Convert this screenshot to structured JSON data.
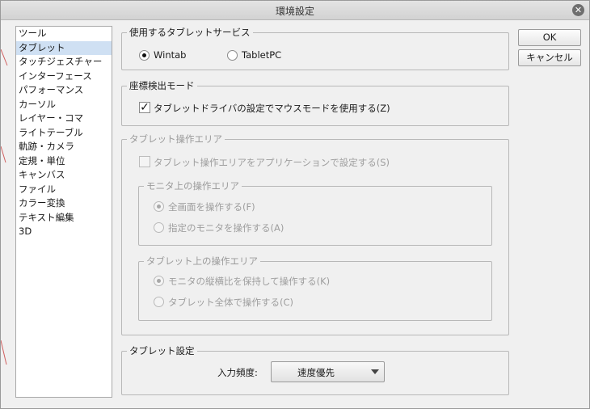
{
  "window": {
    "title": "環境設定"
  },
  "sidebar": {
    "items": [
      {
        "label": "ツール"
      },
      {
        "label": "タブレット"
      },
      {
        "label": "タッチジェスチャー"
      },
      {
        "label": "インターフェース"
      },
      {
        "label": "パフォーマンス"
      },
      {
        "label": "カーソル"
      },
      {
        "label": "レイヤー・コマ"
      },
      {
        "label": "ライトテーブル"
      },
      {
        "label": "軌跡・カメラ"
      },
      {
        "label": "定規・単位"
      },
      {
        "label": "キャンバス"
      },
      {
        "label": "ファイル"
      },
      {
        "label": "カラー変換"
      },
      {
        "label": "テキスト編集"
      },
      {
        "label": "3D"
      }
    ],
    "selected": "タブレット"
  },
  "buttons": {
    "ok": "OK",
    "cancel": "キャンセル"
  },
  "tablet_service": {
    "legend": "使用するタブレットサービス",
    "wintab": "Wintab",
    "tabletpc": "TabletPC",
    "selected": "Wintab"
  },
  "coordinate": {
    "legend": "座標検出モード",
    "mouse_mode_label": "タブレットドライバの設定でマウスモードを使用する(Z)",
    "mouse_mode_checked": true
  },
  "tablet_area": {
    "legend": "タブレット操作エリア",
    "app_setting_label": "タブレット操作エリアをアプリケーションで設定する(S)",
    "app_setting_checked": false,
    "monitor_group": {
      "legend": "モニタ上の操作エリア",
      "full_screen": "全画面を操作する(F)",
      "specific_monitor": "指定のモニタを操作する(A)",
      "selected": "全画面を操作する(F)"
    },
    "tablet_group": {
      "legend": "タブレット上の操作エリア",
      "keep_ratio": "モニタの縦横比を保持して操作する(K)",
      "whole_tablet": "タブレット全体で操作する(C)",
      "selected": "モニタの縦横比を保持して操作する(K)"
    }
  },
  "tablet_settings": {
    "legend": "タブレット設定",
    "input_freq_label": "入力頻度:",
    "input_freq_value": "速度優先"
  },
  "colors": {
    "selection": "#cfe0f3",
    "disabled_text": "#9e9e9e"
  }
}
